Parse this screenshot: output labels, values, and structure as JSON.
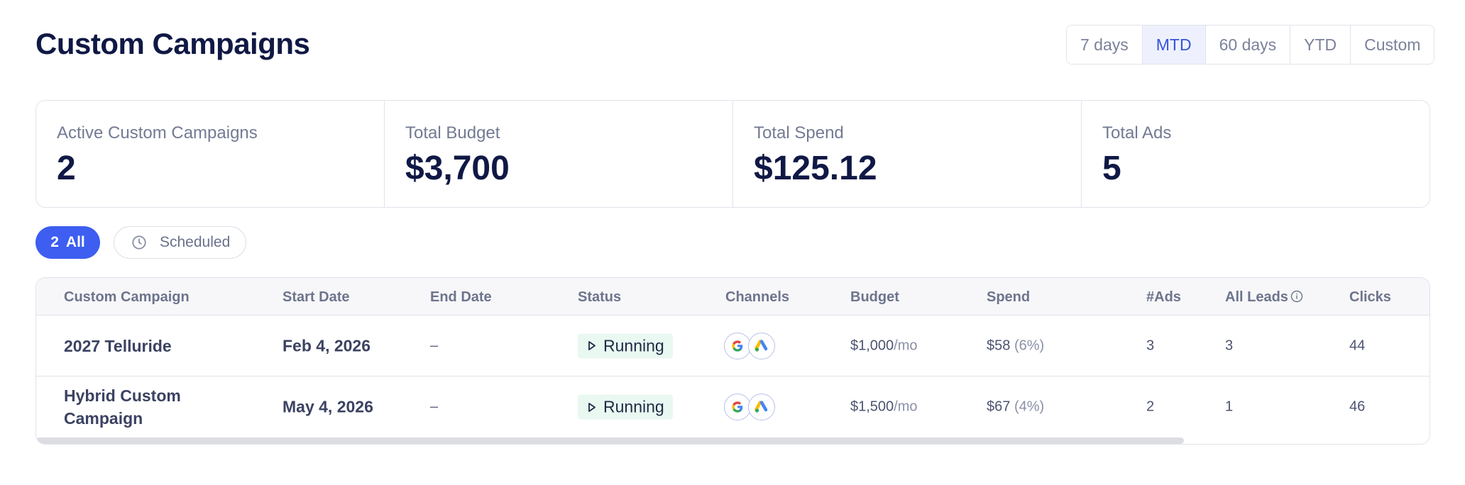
{
  "page": {
    "title": "Custom Campaigns"
  },
  "date_range": {
    "options": [
      "7 days",
      "MTD",
      "60 days",
      "YTD",
      "Custom"
    ],
    "selected": "MTD"
  },
  "stats": [
    {
      "label": "Active Custom Campaigns",
      "value": "2"
    },
    {
      "label": "Total Budget",
      "value": "$3,700"
    },
    {
      "label": "Total Spend",
      "value": "$125.12"
    },
    {
      "label": "Total Ads",
      "value": "5"
    }
  ],
  "filters": {
    "all_count": "2",
    "all_label": "All",
    "scheduled_label": "Scheduled"
  },
  "table": {
    "columns": [
      "Custom Campaign",
      "Start Date",
      "End Date",
      "Status",
      "Channels",
      "Budget",
      "Spend",
      "#Ads",
      "All Leads",
      "Clicks"
    ],
    "rows": [
      {
        "name": "2027 Telluride",
        "start": "Feb 4, 2026",
        "end": "–",
        "status": "Running",
        "channels": [
          "google-icon",
          "google-ads-icon"
        ],
        "budget": "$1,000",
        "budget_unit": "/mo",
        "spend": "$58",
        "spend_pct": "(6%)",
        "ads": "3",
        "leads": "3",
        "clicks": "44"
      },
      {
        "name": "Hybrid Custom Campaign",
        "start": "May 4, 2026",
        "end": "–",
        "status": "Running",
        "channels": [
          "google-icon",
          "google-ads-icon"
        ],
        "budget": "$1,500",
        "budget_unit": "/mo",
        "spend": "$67",
        "spend_pct": "(4%)",
        "ads": "2",
        "leads": "1",
        "clicks": "46"
      }
    ]
  },
  "colors": {
    "accent": "#3d5ef0",
    "status_bg": "#e9f8f1",
    "heading": "#101845"
  }
}
